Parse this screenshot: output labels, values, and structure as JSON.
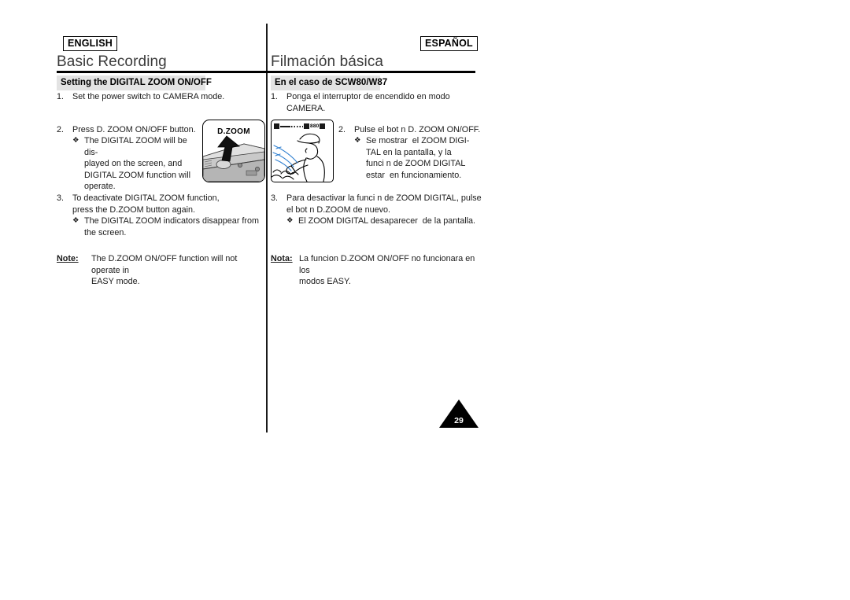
{
  "page": {
    "number": "29"
  },
  "left_column": {
    "language_badge": "ENGLISH",
    "chapter_title": "Basic Recording",
    "section_heading": "Setting the DIGITAL ZOOM ON/OFF",
    "steps": [
      {
        "number": "1.",
        "text": "Set the power switch to CAMERA mode."
      },
      {
        "number": "2.",
        "text": "Press D. ZOOM ON/OFF button.",
        "bullet_mark": "❖",
        "bullet_text": "The DIGITAL ZOOM will be dis-\nplayed on the screen, and\nDIGITAL ZOOM function will\noperate."
      },
      {
        "number": "3.",
        "text": "To deactivate DIGITAL ZOOM function,\npress the D.ZOOM button again.",
        "bullet_mark": "❖",
        "bullet_text": "The DIGITAL ZOOM indicators disappear from\nthe screen."
      }
    ],
    "note": {
      "label": "Note:",
      "text": "The D.ZOOM ON/OFF function will not operate in\nEASY mode."
    }
  },
  "right_column": {
    "language_badge": "ESPAÑOL",
    "chapter_title": "Filmación básica",
    "section_heading": "En el caso de SCW80/W87",
    "steps": [
      {
        "number": "1.",
        "text": "Ponga el interruptor de encendido en modo CAMERA."
      },
      {
        "number": "2.",
        "text": "Pulse el bot n D. ZOOM ON/OFF.",
        "bullet_mark": "❖",
        "bullet_text": "Se mostrar  el ZOOM DIGI-\nTAL en la pantalla, y la\nfunci n de ZOOM DIGITAL\nestar  en funcionamiento."
      },
      {
        "number": "3.",
        "text": "Para desactivar la funci n de ZOOM DIGITAL, pulse\nel bot n D.ZOOM de nuevo.",
        "bullet_mark": "❖",
        "bullet_text": "El ZOOM DIGITAL desaparecer  de la pantalla."
      }
    ],
    "note": {
      "label": "Nota:",
      "text": "La funcion D.ZOOM ON/OFF no funcionara en los\nmodos EASY."
    }
  },
  "figures": {
    "camcorder": {
      "button_label": "D.ZOOM"
    },
    "viewfinder": {
      "zoom_indicator_wide": "W",
      "zoom_indicator_tele": "T",
      "zoom_value": "880"
    }
  }
}
